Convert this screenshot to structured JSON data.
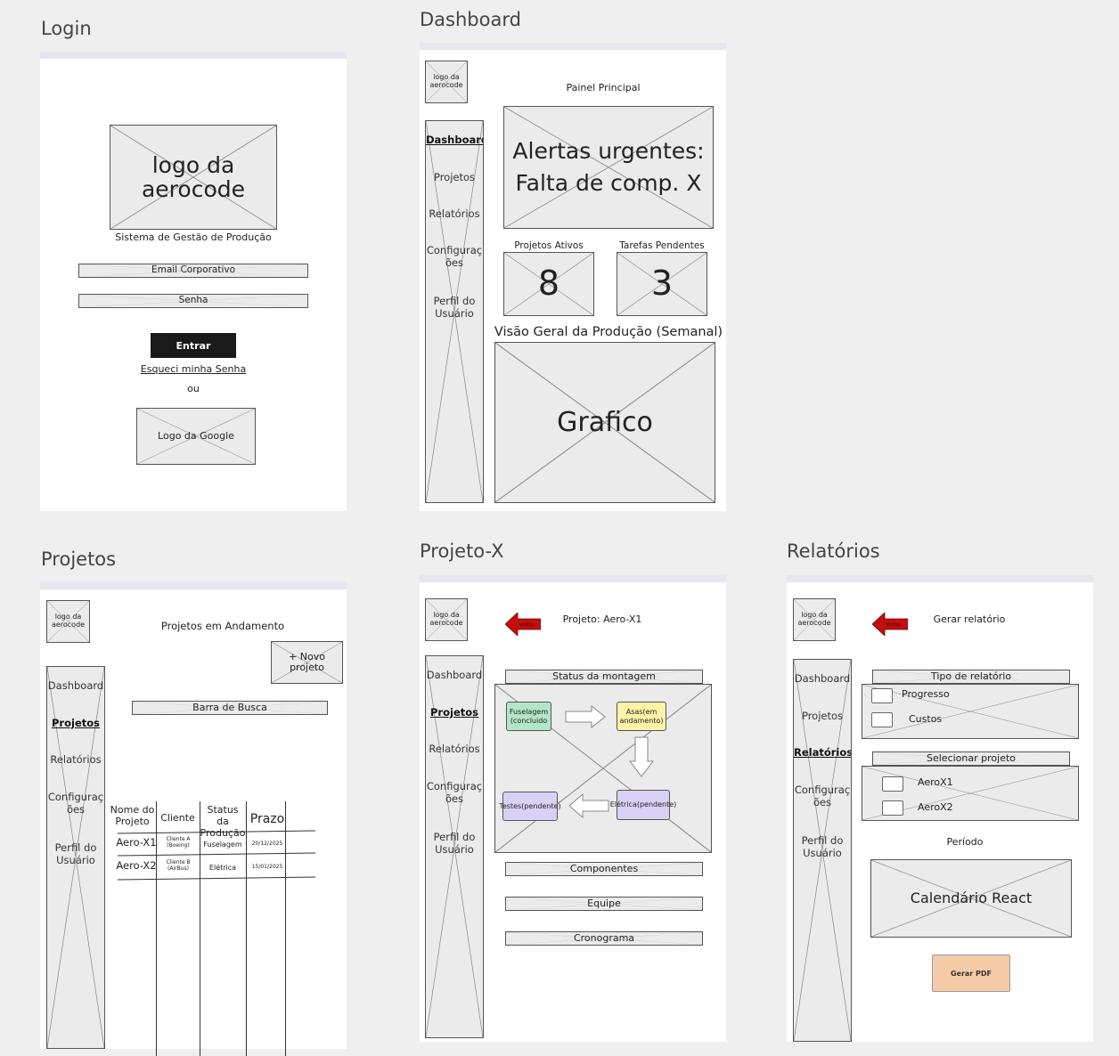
{
  "login": {
    "frame_title": "Login",
    "logo": "logo da aerocode",
    "subtitle": "Sistema de Gestão de Produção",
    "email_placeholder": "Email Corporativo",
    "password_placeholder": "Senha",
    "enter_button": "Entrar",
    "forgot_link": "Esqueci minha Senha",
    "or_text": "ou",
    "google_logo": "Logo da Google"
  },
  "dashboard": {
    "frame_title": "Dashboard",
    "logo": "logo da aerocode",
    "sidebar": [
      "Dashboard",
      "Projetos",
      "Relatórios",
      "Configurações",
      "Perfil do Usuário"
    ],
    "header": "Painel Principal",
    "alert": "Alertas urgentes: Falta de comp. X",
    "active_projects_label": "Projetos Ativos",
    "active_projects_value": "8",
    "pending_tasks_label": "Tarefas Pendentes",
    "pending_tasks_value": "3",
    "overview_label": "Visão Geral da Produção (Semanal)",
    "chart_placeholder": "Grafico"
  },
  "projetos": {
    "frame_title": "Projetos",
    "logo": "logo da aerocode",
    "sidebar": [
      "Dashboard",
      "Projetos",
      "Relatórios",
      "Configurações",
      "Perfil do Usuário"
    ],
    "header": "Projetos em Andamento",
    "new_project_button": "+ Novo projeto",
    "search_bar": "Barra de Busca",
    "table": {
      "headers": [
        "Nome do Projeto",
        "Cliente",
        "Status da Produção",
        "Prazo"
      ],
      "rows": [
        [
          "Aero-X1",
          "Cliente A (Boeing)",
          "Fuselagem",
          "20/12/2025"
        ],
        [
          "Aero-X2",
          "Cliente B (AirBus)",
          "Elétrica",
          "15/01/2025"
        ]
      ]
    }
  },
  "projeto_x": {
    "frame_title": "Projeto-X",
    "logo": "logo da aerocode",
    "sidebar": [
      "Dashboard",
      "Projetos",
      "Relatórios",
      "Configurações",
      "Perfil do Usuário"
    ],
    "back_label": "Voltar",
    "header": "Projeto: Aero-X1",
    "status_label": "Status da montagem",
    "stages": {
      "fuselagem": "Fuselagem (concluido",
      "asas": "Asas(em andamento)",
      "eletrica": "Elétrica(pendente)",
      "testes": "Testes(pendente)"
    },
    "stage_colors": {
      "done": "#b3e6c8",
      "progress": "#fff3a8",
      "pending": "#d8d0f5"
    },
    "sections": [
      "Componentes",
      "Equipe",
      "Cronograma"
    ]
  },
  "relatorios": {
    "frame_title": "Relatórios",
    "logo": "logo da aerocode",
    "sidebar": [
      "Dashboard",
      "Projetos",
      "Relatórios",
      "Configurações",
      "Perfil do Usuário"
    ],
    "back_label": "Voltar",
    "header": "Gerar relatório",
    "report_type_label": "Tipo de relatório",
    "report_options": [
      "Progresso",
      "Custos"
    ],
    "select_project_label": "Selecionar projeto",
    "project_options": [
      "AeroX1",
      "AeroX2"
    ],
    "period_label": "Período",
    "calendar_placeholder": "Calendário React",
    "pdf_button": "Gerar PDF"
  },
  "colors": {
    "back_arrow": "#c01010",
    "pdf_button": "#f5cba7",
    "dark_button": "#1a1a1a"
  }
}
